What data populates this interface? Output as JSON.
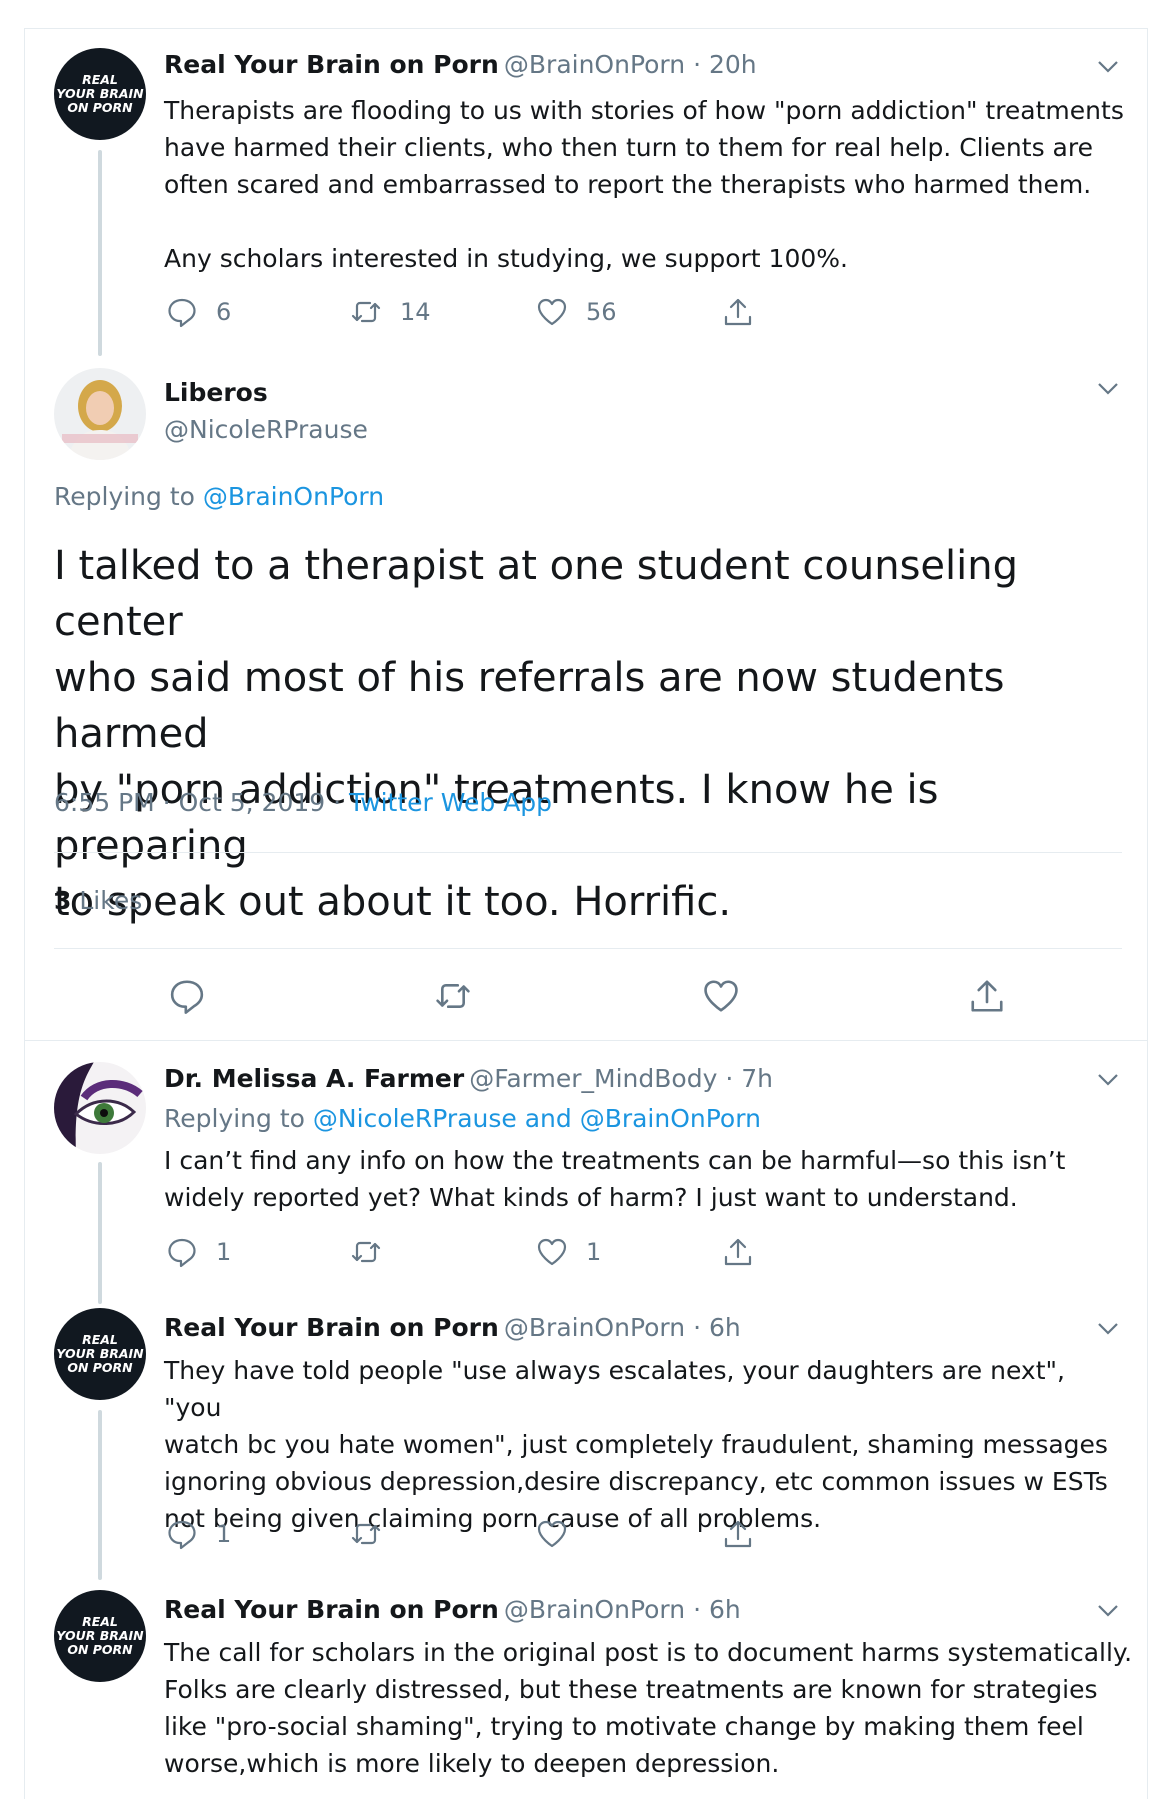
{
  "tweet1": {
    "logo_text": [
      "REAL",
      "YOUR BRAIN",
      "ON PORN"
    ],
    "name": "Real Your Brain on Porn",
    "handle": "@BrainOnPorn · 20h",
    "text": "Therapists are flooding to us with stories of how \"porn addiction\" treatments\nhave harmed their clients, who then turn to them for real help. Clients are\noften scared and embarrassed to report the therapists who harmed them.\n\nAny scholars interested in studying, we support 100%.",
    "replies": "6",
    "retweets": "14",
    "likes": "56"
  },
  "main": {
    "name": "Liberos",
    "handle": "@NicoleRPrause",
    "replying_label": "Replying to ",
    "replying_handle": "@BrainOnPorn",
    "text": "I talked to a therapist at one student counseling center\nwho said most of his referrals are now students harmed\nby \"porn addiction\" treatments. I know he is preparing\nto speak out about it too. Horrific.",
    "timestamp": "6:55 PM · Oct 5, 2019 · ",
    "source": "Twitter Web App",
    "likes_count": "3",
    "likes_label": " Likes"
  },
  "reply1": {
    "name": "Dr. Melissa A. Farmer",
    "handle": "@Farmer_MindBody · 7h",
    "replying_label": "Replying to ",
    "replying_handles": "@NicoleRPrause and @BrainOnPorn",
    "text": "I can’t find any info on how the treatments can be harmful—so this isn’t\nwidely reported yet? What kinds of harm? I just want to understand.",
    "replies": "1",
    "retweets": "",
    "likes": "1"
  },
  "reply2": {
    "logo_text": [
      "REAL",
      "YOUR BRAIN",
      "ON PORN"
    ],
    "name": "Real Your Brain on Porn",
    "handle": "@BrainOnPorn · 6h",
    "text": "They have told people \"use always escalates, your daughters are next\", \"you\nwatch bc you hate women\", just completely fraudulent, shaming messages\nignoring obvious depression,desire discrepancy, etc common issues w ESTs\nnot being given claiming porn cause of all problems.",
    "replies": "1",
    "retweets": "",
    "likes": ""
  },
  "reply3": {
    "logo_text": [
      "REAL",
      "YOUR BRAIN",
      "ON PORN"
    ],
    "name": "Real Your Brain on Porn",
    "handle": "@BrainOnPorn · 6h",
    "text": "The call for scholars in the original post is to document harms systematically.\nFolks are clearly distressed, but these treatments are known for strategies\nlike \"pro-social shaming\", trying to motivate change by making them feel\nworse,which is more likely to deepen depression."
  },
  "colors": {
    "accent": "#1b95e0",
    "secondary_text": "#657786",
    "divider": "#e6ecf0"
  }
}
